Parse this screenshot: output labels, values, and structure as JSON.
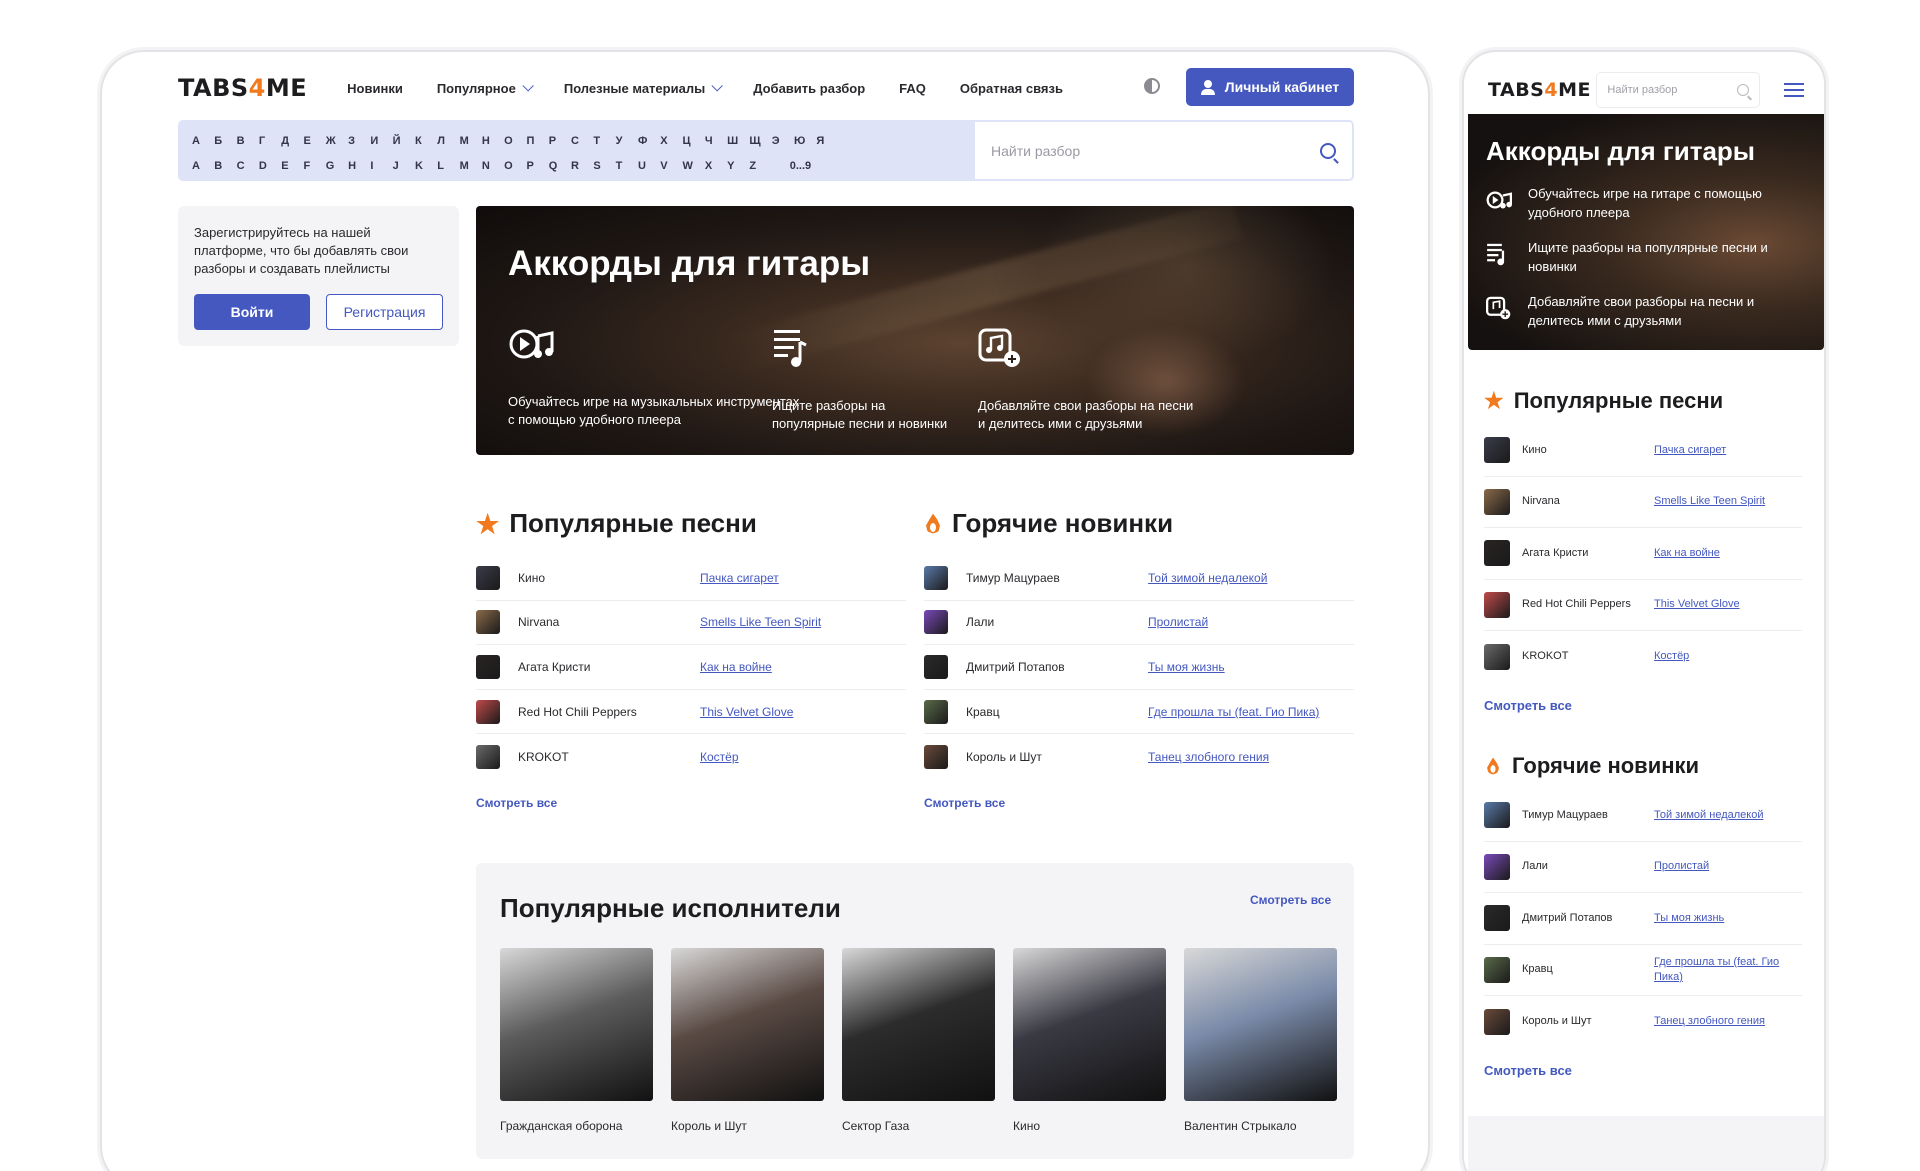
{
  "brand": {
    "logo_a": "TABS",
    "logo_4": "4",
    "logo_b": "ME"
  },
  "nav": {
    "items": [
      {
        "label": "Новинки",
        "dropdown": false
      },
      {
        "label": "Популярное",
        "dropdown": true
      },
      {
        "label": "Полезные материалы",
        "dropdown": true
      },
      {
        "label": "Добавить разбор",
        "dropdown": false
      },
      {
        "label": "FAQ",
        "dropdown": false
      },
      {
        "label": "Обратная связь",
        "dropdown": false
      }
    ],
    "cabinet_label": "Личный кабинет"
  },
  "alphabet": {
    "cyrillic": [
      "А",
      "Б",
      "В",
      "Г",
      "Д",
      "Е",
      "Ж",
      "З",
      "И",
      "Й",
      "К",
      "Л",
      "М",
      "Н",
      "О",
      "П",
      "Р",
      "С",
      "Т",
      "У",
      "Ф",
      "Х",
      "Ц",
      "Ч",
      "Ш",
      "Щ",
      "Э",
      "Ю",
      "Я"
    ],
    "latin": [
      "A",
      "B",
      "C",
      "D",
      "E",
      "F",
      "G",
      "H",
      "I",
      "J",
      "K",
      "L",
      "M",
      "N",
      "O",
      "P",
      "Q",
      "R",
      "S",
      "T",
      "U",
      "V",
      "W",
      "X",
      "Y",
      "Z"
    ],
    "digits": "0...9"
  },
  "search": {
    "placeholder": "Найти разбор"
  },
  "register": {
    "text": "Зарегистрируйтесь на нашей платформе, что бы добавлять свои разборы и создавать плейлисты",
    "login_label": "Войти",
    "register_label": "Регистрация"
  },
  "hero": {
    "title": "Аккорды для гитары",
    "features": [
      {
        "icon": "play-music-icon",
        "text": "Обучайтесь игре на музыкальных инструментах с помощью удобного плеера"
      },
      {
        "icon": "music-list-icon",
        "text": "Ищите разборы на популярные песни и новинки"
      },
      {
        "icon": "add-music-icon",
        "text": "Добавляйте свои разборы на песни и делитесь ими с друзьями"
      }
    ]
  },
  "mobile_hero": {
    "title": "Аккорды для гитары",
    "features": [
      {
        "icon": "play-music-icon",
        "text": "Обучайтесь игре на гитаре с помощью удобного плеера"
      },
      {
        "icon": "music-list-icon",
        "text": "Ищите разборы на популярные песни и новинки"
      },
      {
        "icon": "add-music-icon",
        "text": "Добавляйте свои разборы на песни и делитесь ими с друзьями"
      }
    ]
  },
  "popular_songs": {
    "title": "Популярные песни",
    "icon": "star-icon",
    "see_all": "Смотреть все",
    "items": [
      {
        "artist": "Кино",
        "track": "Пачка сигарет",
        "color": "#3a3c4a"
      },
      {
        "artist": "Nirvana",
        "track": "Smells Like Teen Spirit",
        "color": "#8a6a4a"
      },
      {
        "artist": "Агата Кристи",
        "track": "Как на войне",
        "color": "#2a2424"
      },
      {
        "artist": "Red Hot Chili Peppers",
        "track": "This Velvet Glove",
        "color": "#c04a4a"
      },
      {
        "artist": "KROKOT",
        "track": "Костёр",
        "color": "#6a6a6a"
      }
    ]
  },
  "hot_new": {
    "title": "Горячие новинки",
    "icon": "fire-icon",
    "see_all": "Смотреть все",
    "items": [
      {
        "artist": "Тимур Мацураев",
        "track": "Той зимой недалекой",
        "color": "#5a7aa8"
      },
      {
        "artist": "Лали",
        "track": "Пролистай",
        "color": "#7a4ab8"
      },
      {
        "artist": "Дмитрий Потапов",
        "track": "Ты моя жизнь",
        "color": "#2a2a2a"
      },
      {
        "artist": "Кравц",
        "track": "Где прошла ты (feat. Гио Пика)",
        "color": "#5a6a4a"
      },
      {
        "artist": "Король и Шут",
        "track": "Танец злобного гения",
        "color": "#6a4a3a"
      }
    ]
  },
  "popular_artists": {
    "title": "Популярные исполнители",
    "see_all": "Смотреть все",
    "items": [
      {
        "name": "Гражданская оборона",
        "color": "#5c5c5c"
      },
      {
        "name": "Король и Шут",
        "color": "#5a4a44"
      },
      {
        "name": "Сектор Газа",
        "color": "#2c2c2c"
      },
      {
        "name": "Кино",
        "color": "#3a3a44"
      },
      {
        "name": "Валентин Стрыкало",
        "color": "#7a8aa8"
      }
    ]
  },
  "colors": {
    "accent": "#4458c0",
    "brand_orange": "#f07a1d",
    "alpha_bg": "#dfe3f7"
  }
}
